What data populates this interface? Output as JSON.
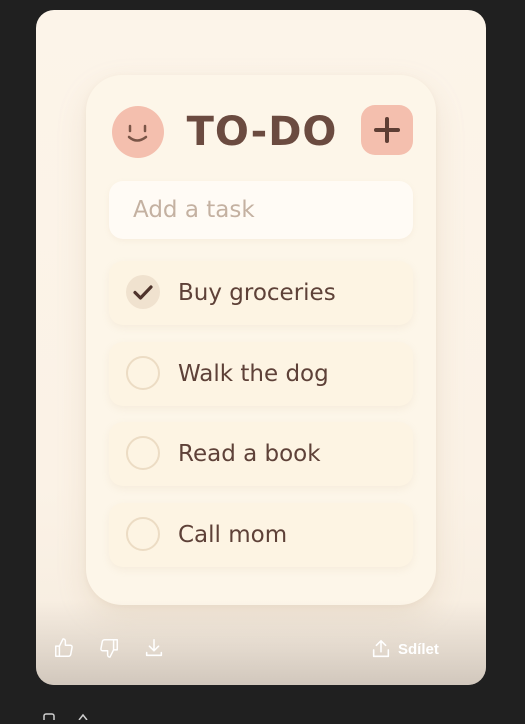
{
  "app": {
    "title": "TO-DO"
  },
  "header": {
    "avatar_icon": "smiley-face-icon",
    "add_icon": "plus-icon"
  },
  "input": {
    "placeholder": "Add a task",
    "value": ""
  },
  "tasks": [
    {
      "label": "Buy groceries",
      "done": true
    },
    {
      "label": "Walk the dog",
      "done": false
    },
    {
      "label": "Read a book",
      "done": false
    },
    {
      "label": "Call mom",
      "done": false
    }
  ],
  "toolbar": {
    "like_icon": "thumbs-up-icon",
    "dislike_icon": "thumbs-down-icon",
    "download_icon": "download-icon",
    "share_icon": "share-icon",
    "share_label": "Sdílet"
  },
  "colors": {
    "page_background": "#202020",
    "frame_background": "#fcf4e9",
    "card_background": "#fdf6e9",
    "accent_pink": "#f4bfae",
    "text_brown": "#6b4b40",
    "placeholder_text": "#c4b1a1",
    "checkbox_border": "#ecdcc4"
  }
}
